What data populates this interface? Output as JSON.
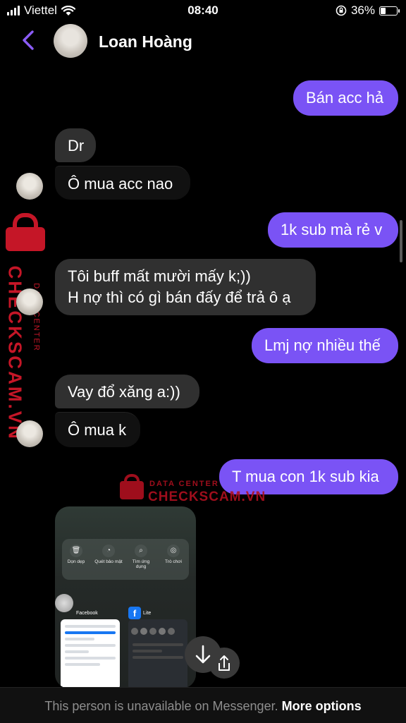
{
  "status": {
    "carrier": "Viettel",
    "time": "08:40",
    "battery_percent": "36%",
    "battery_level": 0.36
  },
  "header": {
    "contact_name": "Loan Hoàng"
  },
  "messages": [
    {
      "side": "out",
      "text": "Bán acc hả"
    },
    {
      "side": "in",
      "text": "Dr"
    },
    {
      "side": "in",
      "text": "Ô mua acc nao"
    },
    {
      "side": "out",
      "text": "1k sub mà rẻ v"
    },
    {
      "side": "in",
      "line1": "Tôi buff mất mười mấy k;))",
      "line2": "H nợ thì có gì bán đấy để trả ô ạ"
    },
    {
      "side": "out",
      "text": "Lmj nợ nhiều thế"
    },
    {
      "side": "in",
      "text": "Vay đổ xăng a:))"
    },
    {
      "side": "in",
      "text": "Ô mua k"
    },
    {
      "side": "out",
      "text": "T mua con 1k sub kia"
    }
  ],
  "attachment": {
    "quick_settings": [
      "Dọn dẹp",
      "Quét bảo mật",
      "Tìm ứng dụng",
      "Trò chơi"
    ],
    "apps": [
      "Facebook",
      "Lite"
    ]
  },
  "watermark": {
    "label_small": "DATA CENTER",
    "label_big": "CHECKSCAM.VN"
  },
  "footer": {
    "message": "This person is unavailable on Messenger.",
    "action": "More options"
  }
}
